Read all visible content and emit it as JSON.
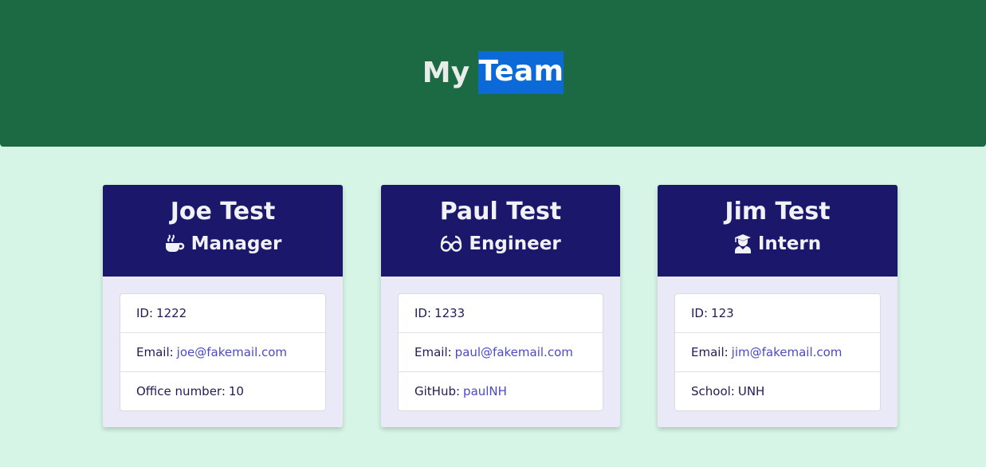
{
  "header": {
    "title_word1": "My",
    "title_word2": "Team"
  },
  "colors": {
    "header_bg": "#1b6a43",
    "page_bg": "#d6f5e6",
    "card_header_bg": "#1b176b",
    "link": "#4b49c7",
    "selection": "#0b6ad7"
  },
  "cards": [
    {
      "name": "Joe Test",
      "role": "Manager",
      "icon": "coffee-icon",
      "id_label": "ID:",
      "id_value": "1222",
      "email_label": "Email:",
      "email_value": "joe@fakemail.com",
      "extra_label": "Office number:",
      "extra_value": "10"
    },
    {
      "name": "Paul Test",
      "role": "Engineer",
      "icon": "glasses-icon",
      "id_label": "ID:",
      "id_value": "1233",
      "email_label": "Email:",
      "email_value": "paul@fakemail.com",
      "extra_label": "GitHub:",
      "extra_value": "paulNH"
    },
    {
      "name": "Jim Test",
      "role": "Intern",
      "icon": "graduate-icon",
      "id_label": "ID:",
      "id_value": "123",
      "email_label": "Email:",
      "email_value": "jim@fakemail.com",
      "extra_label": "School:",
      "extra_value": "UNH"
    }
  ]
}
